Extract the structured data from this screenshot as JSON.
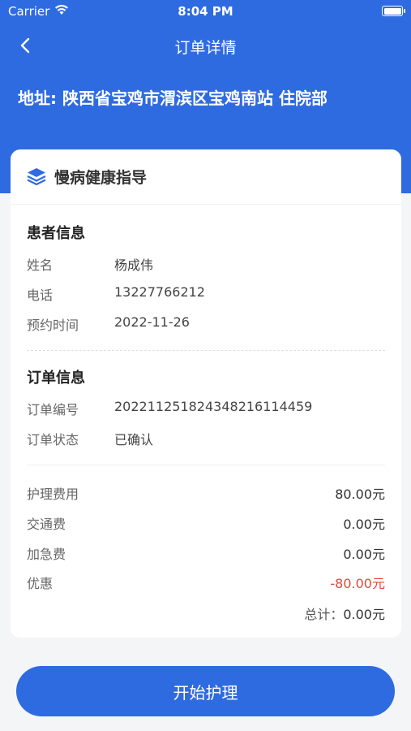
{
  "status_bar": {
    "carrier": "Carrier",
    "time": "8:04 PM",
    "wifi_icon": "wifi-icon",
    "battery_icon": "battery-icon"
  },
  "nav": {
    "title": "订单详情",
    "back_icon": "chevron-left-icon"
  },
  "address": "地址: 陕西省宝鸡市渭滨区宝鸡南站 住院部",
  "service": {
    "icon": "layers-icon",
    "name": "慢病健康指导"
  },
  "patient": {
    "section_title": "患者信息",
    "rows": [
      {
        "label": "姓名",
        "value": "杨成伟"
      },
      {
        "label": "电话",
        "value": "13227766212"
      },
      {
        "label": "预约时间",
        "value": "2022-11-26"
      }
    ]
  },
  "order": {
    "section_title": "订单信息",
    "rows": [
      {
        "label": "订单编号",
        "value": "20221125182434821611 4459"
      },
      {
        "label": "订单状态",
        "value": "已确认"
      }
    ]
  },
  "fees": [
    {
      "label": "护理费用",
      "amount": "80.00元"
    },
    {
      "label": "交通费",
      "amount": "0.00元"
    },
    {
      "label": "加急费",
      "amount": "0.00元"
    },
    {
      "label": "优惠",
      "amount": "-80.00元"
    }
  ],
  "total": {
    "label": "总计：",
    "amount": "0.00元"
  },
  "cta_label": "开始护理",
  "colors": {
    "primary": "#2f6be0",
    "discount": "#e8453c",
    "background": "#f4f5f7"
  }
}
